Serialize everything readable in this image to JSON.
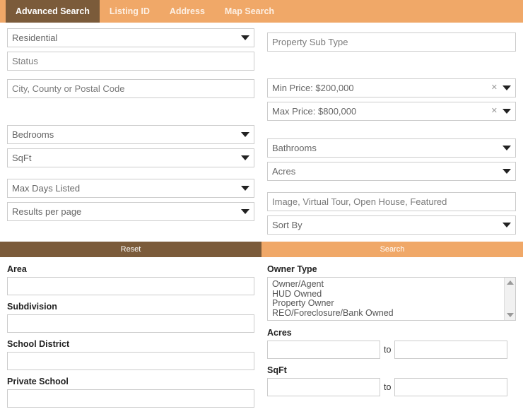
{
  "tabs": [
    {
      "label": "Advanced Search",
      "active": true
    },
    {
      "label": "Listing ID",
      "active": false
    },
    {
      "label": "Address",
      "active": false
    },
    {
      "label": "Map Search",
      "active": false
    }
  ],
  "colors": {
    "tab_bar_bg": "#f0a868",
    "active_tab_bg": "#7b5b3a",
    "reset_bg": "#7b5b3a",
    "search_bg": "#f0a868",
    "field_border": "#cccccc",
    "placeholder_text": "#7a7a7a"
  },
  "search_form": {
    "left_column": [
      {
        "name": "property-type",
        "kind": "select",
        "value": "Residential"
      },
      {
        "name": "status",
        "kind": "text",
        "value": "Status"
      },
      {
        "name": "location",
        "kind": "text",
        "value": "City, County or Postal Code"
      },
      {
        "name": "bedrooms",
        "kind": "select",
        "value": "Bedrooms"
      },
      {
        "name": "sqft",
        "kind": "select",
        "value": "SqFt"
      },
      {
        "name": "max-days-listed",
        "kind": "select",
        "value": "Max Days Listed"
      },
      {
        "name": "results-per-page",
        "kind": "select",
        "value": "Results per page"
      }
    ],
    "right_column": [
      {
        "name": "property-sub-type",
        "kind": "text",
        "value": "Property Sub Type"
      },
      {
        "name": "min-price",
        "kind": "select-clear",
        "value": "Min Price: $200,000",
        "clear_icon": "close-icon"
      },
      {
        "name": "max-price",
        "kind": "select-clear",
        "value": "Max Price: $800,000",
        "clear_icon": "close-icon"
      },
      {
        "name": "bathrooms",
        "kind": "select",
        "value": "Bathrooms"
      },
      {
        "name": "acres",
        "kind": "select",
        "value": "Acres"
      },
      {
        "name": "features",
        "kind": "text",
        "value": "Image, Virtual Tour, Open House, Featured"
      },
      {
        "name": "sort-by",
        "kind": "select",
        "value": "Sort By"
      }
    ]
  },
  "actions": {
    "reset_label": "Reset",
    "search_label": "Search"
  },
  "details": {
    "left_fields": [
      {
        "name": "area",
        "label": "Area",
        "value": ""
      },
      {
        "name": "subdivision",
        "label": "Subdivision",
        "value": ""
      },
      {
        "name": "school-district",
        "label": "School District",
        "value": ""
      },
      {
        "name": "private-school",
        "label": "Private School",
        "value": ""
      }
    ],
    "owner_type": {
      "label": "Owner Type",
      "options": [
        "Owner/Agent",
        "HUD Owned",
        "Property Owner",
        "REO/Foreclosure/Bank Owned"
      ]
    },
    "ranges": [
      {
        "name": "acres",
        "label": "Acres",
        "separator": "to",
        "min": "",
        "max": ""
      },
      {
        "name": "sqft",
        "label": "SqFt",
        "separator": "to",
        "min": "",
        "max": ""
      }
    ]
  }
}
